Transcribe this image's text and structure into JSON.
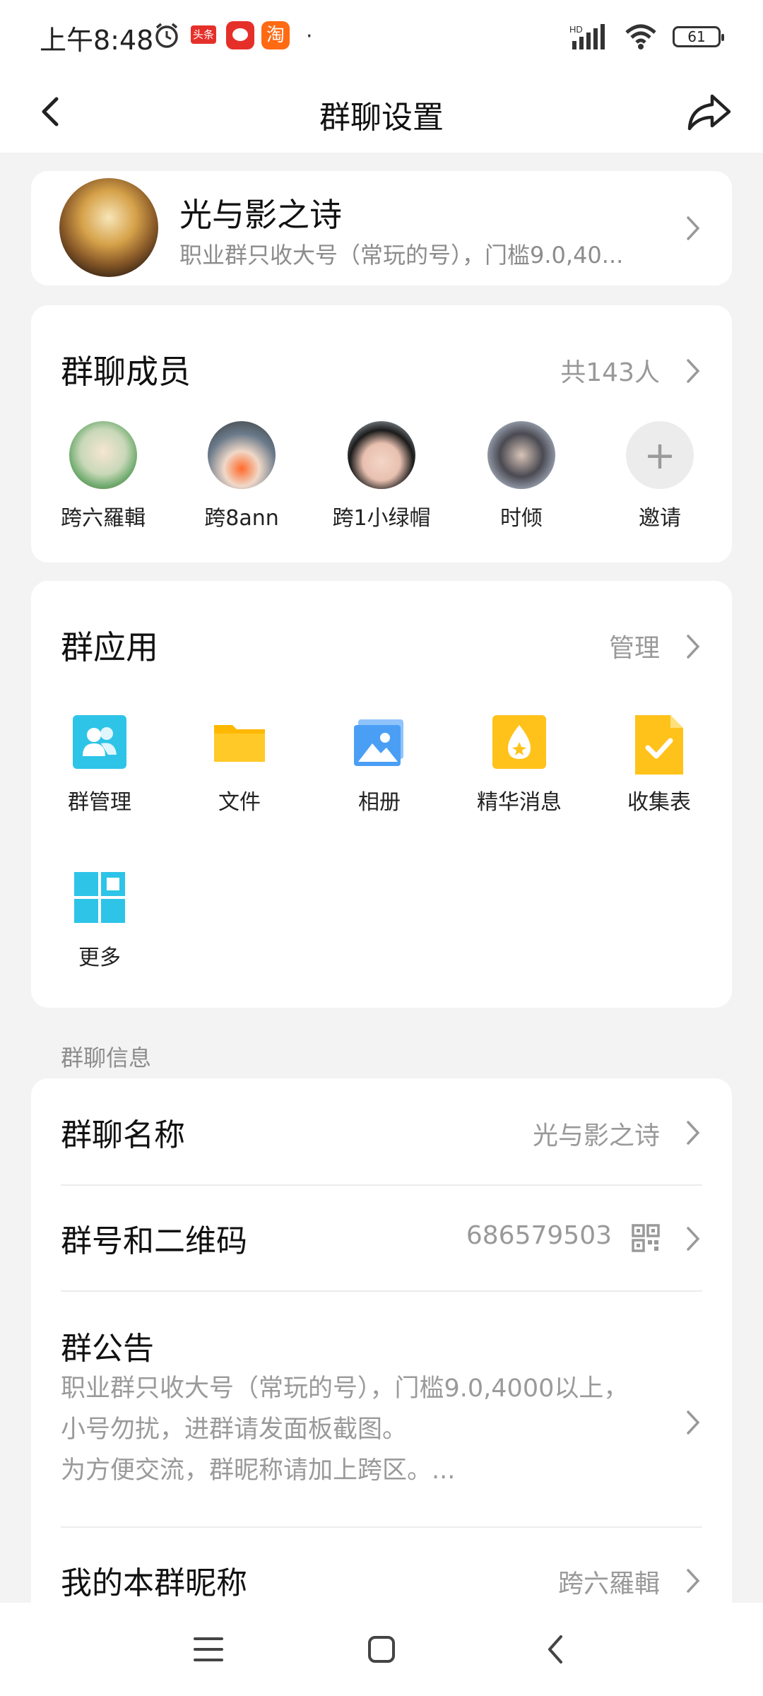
{
  "status_bar": {
    "time": "上午8:48",
    "notif_icons": [
      "alarm-icon",
      "toutiao-icon",
      "pinduoduo-icon",
      "taobao-icon"
    ],
    "toutiao_label": "头条",
    "taobao_label": "淘",
    "dot": "·",
    "hd_label": "HD",
    "battery": "61"
  },
  "nav": {
    "title": "群聊设置"
  },
  "group": {
    "name": "光与影之诗",
    "desc": "职业群只收大号（常玩的号），门槛9.0,40..."
  },
  "members": {
    "title": "群聊成员",
    "count": "共143人",
    "items": [
      {
        "name": "跨六羅輯"
      },
      {
        "name": "跨8ann"
      },
      {
        "name": "跨1小绿帽"
      },
      {
        "name": "时倾"
      }
    ],
    "invite_label": "邀请"
  },
  "apps": {
    "title": "群应用",
    "manage": "管理",
    "items": [
      {
        "label": "群管理",
        "icon": "group-manage-icon",
        "color": "#2ec4e8"
      },
      {
        "label": "文件",
        "icon": "folder-icon",
        "color": "#ffc21a"
      },
      {
        "label": "相册",
        "icon": "album-icon",
        "color": "#4a9ff5"
      },
      {
        "label": "精华消息",
        "icon": "essence-icon",
        "color": "#ffc21a"
      },
      {
        "label": "收集表",
        "icon": "form-icon",
        "color": "#ffc21a"
      },
      {
        "label": "更多",
        "icon": "more-icon",
        "color": "#2ec4e8"
      }
    ]
  },
  "info": {
    "caption": "群聊信息",
    "name_label": "群聊名称",
    "name_value": "光与影之诗",
    "number_label": "群号和二维码",
    "number_value": "686579503",
    "notice_label": "群公告",
    "notice_lines": [
      "职业群只收大号（常玩的号），门槛9.0,4000以上，",
      "小号勿扰，进群请发面板截图。",
      "为方便交流，群昵称请加上跨区。..."
    ],
    "nick_label": "我的本群昵称",
    "nick_value": "跨六羅輯"
  }
}
